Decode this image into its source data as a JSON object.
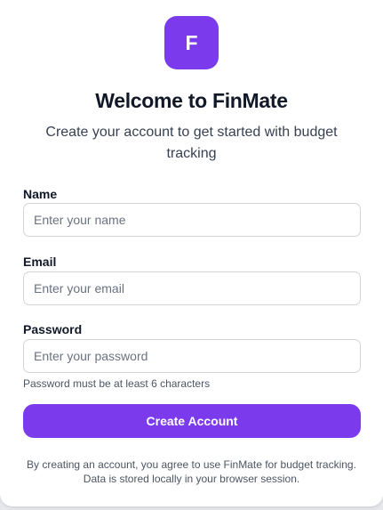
{
  "brand": {
    "logo_letter": "F",
    "accent_color": "#7c3aed"
  },
  "header": {
    "title": "Welcome to FinMate",
    "subtitle": "Create your account to get started with budget tracking"
  },
  "form": {
    "name": {
      "label": "Name",
      "placeholder": "Enter your name",
      "value": ""
    },
    "email": {
      "label": "Email",
      "placeholder": "Enter your email",
      "value": ""
    },
    "password": {
      "label": "Password",
      "placeholder": "Enter your password",
      "value": "",
      "hint": "Password must be at least 6 characters"
    },
    "submit_label": "Create Account"
  },
  "footer": {
    "line1": "By creating an account, you agree to use FinMate for budget tracking.",
    "line2": "Data is stored locally in your browser session."
  }
}
